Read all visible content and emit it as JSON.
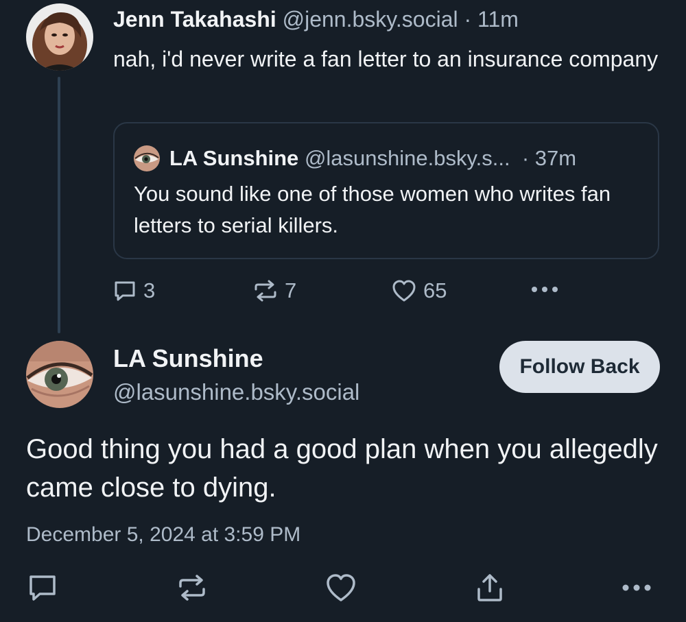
{
  "parent_post": {
    "author_name": "Jenn Takahashi",
    "author_handle": "@jenn.bsky.social",
    "separator": " · ",
    "time_ago": "11m",
    "text": "nah, i'd never write a fan letter to an insurance company",
    "avatar_icon": "profile-photo-woman",
    "quote": {
      "author_name": "LA Sunshine",
      "author_handle": "@lasunshine.bsky.s...",
      "time_ago": "· 37m",
      "text": "You sound like one of those women who writes fan letters to serial killers.",
      "avatar_icon": "profile-photo-eye"
    },
    "actions": {
      "reply_count": "3",
      "repost_count": "7",
      "like_count": "65",
      "reply_icon": "reply-bubble-icon",
      "repost_icon": "repost-icon",
      "like_icon": "heart-icon",
      "more_icon": "more-dots-icon"
    }
  },
  "main_post": {
    "author_name": "LA Sunshine",
    "author_handle": "@lasunshine.bsky.social",
    "follow_label": "Follow Back",
    "text": "Good thing you had a good plan when you allegedly came close to dying.",
    "timestamp": "December 5, 2024 at 3:59 PM",
    "avatar_icon": "profile-photo-eye",
    "actions": [
      "reply-bubble-icon",
      "repost-icon",
      "heart-icon",
      "share-icon",
      "more-dots-icon"
    ]
  },
  "colors": {
    "background": "#161e27",
    "text": "#f1f3f5",
    "muted": "#aebbc9",
    "thread_line": "#2e4052",
    "card_border": "#2a3746",
    "follow_button_bg": "#dce2ea",
    "follow_button_text": "#1e2a36"
  }
}
